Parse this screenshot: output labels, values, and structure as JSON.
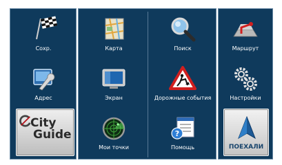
{
  "left_panel": {
    "items": [
      {
        "label": "Сохр.",
        "icon": "checkered-flag-icon"
      },
      {
        "label": "Адрес",
        "icon": "wrench-screen-icon"
      }
    ],
    "city_guide": {
      "line1": "City",
      "line2": "Guide",
      "icon": "cityguide-logo-icon"
    }
  },
  "mid_panel": {
    "items": [
      {
        "label": "Карта",
        "icon": "map-icon"
      },
      {
        "label": "Поиск",
        "icon": "magnifier-icon"
      },
      {
        "label": "Экран",
        "icon": "monitor-icon"
      },
      {
        "label": "Дорожные события",
        "icon": "road-works-sign-icon"
      },
      {
        "label": "Мои точки",
        "icon": "radar-icon"
      },
      {
        "label": "Помощь",
        "icon": "help-window-icon"
      }
    ]
  },
  "right_panel": {
    "items": [
      {
        "label": "Маршрут",
        "icon": "route-icon"
      },
      {
        "label": "Настройки",
        "icon": "gears-icon"
      }
    ],
    "go_button": {
      "label": "ПОЕХАЛИ",
      "icon": "navigation-arrow-icon"
    }
  },
  "colors": {
    "panel": "#0f3a5c",
    "border": "#6a8aa5",
    "go_text": "#16436b"
  }
}
